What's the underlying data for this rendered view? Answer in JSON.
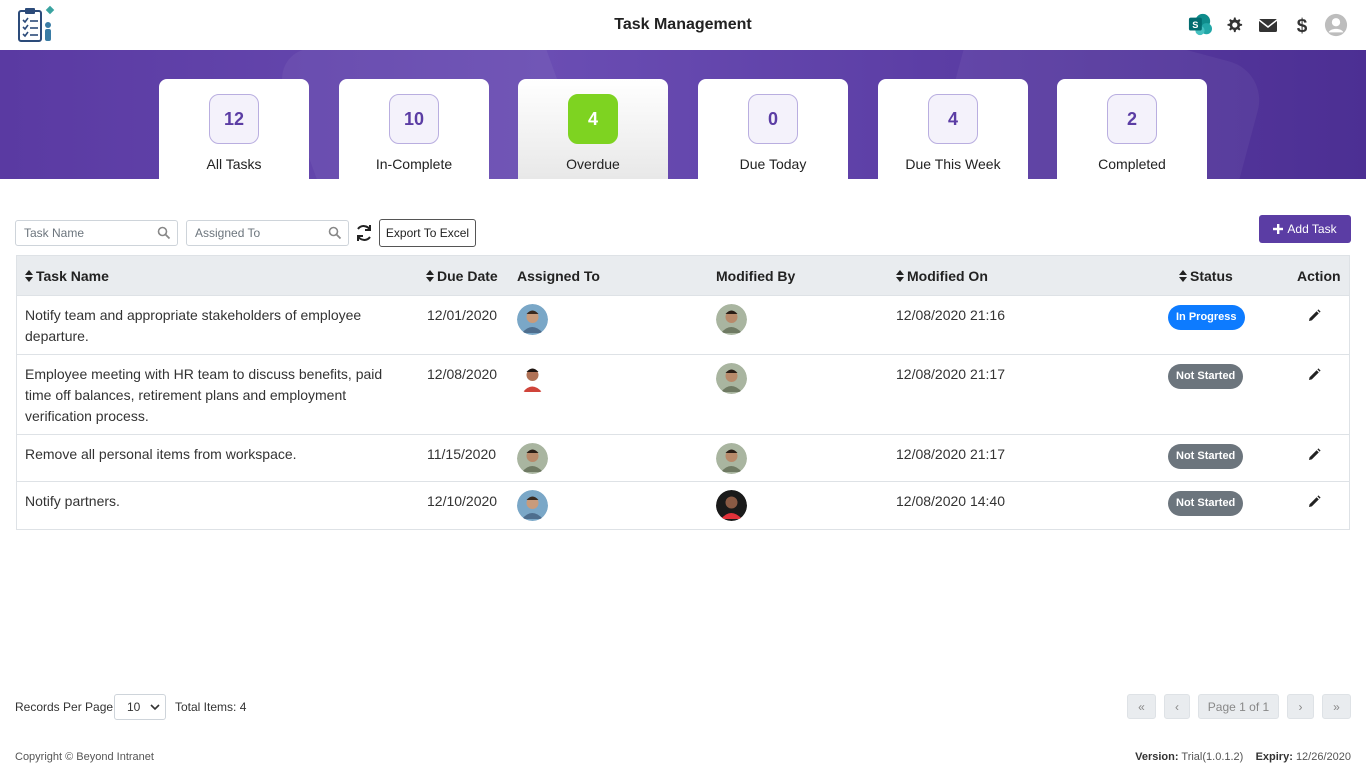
{
  "header": {
    "title": "Task Management",
    "icons": [
      "sharepoint-icon",
      "gear-icon",
      "envelope-icon",
      "dollar-icon",
      "user-avatar-icon"
    ]
  },
  "tiles": [
    {
      "count": "12",
      "label": "All Tasks",
      "active": false
    },
    {
      "count": "10",
      "label": "In-Complete",
      "active": false
    },
    {
      "count": "4",
      "label": "Overdue",
      "active": true
    },
    {
      "count": "0",
      "label": "Due Today",
      "active": false
    },
    {
      "count": "4",
      "label": "Due This Week",
      "active": false
    },
    {
      "count": "2",
      "label": "Completed",
      "active": false
    }
  ],
  "filters": {
    "task_name_placeholder": "Task Name",
    "assigned_to_placeholder": "Assigned To",
    "export_label": "Export To Excel",
    "add_task_label": "Add Task"
  },
  "table": {
    "columns": {
      "task_name": "Task Name",
      "due_date": "Due Date",
      "assigned_to": "Assigned To",
      "modified_by": "Modified By",
      "modified_on": "Modified On",
      "status": "Status",
      "action": "Action"
    },
    "rows": [
      {
        "task_name": "Notify team and appropriate stakeholders of employee departure.",
        "due_date": "12/01/2020",
        "modified_on": "12/08/2020 21:16",
        "status": "In Progress"
      },
      {
        "task_name": "Employee meeting with HR team to discuss benefits, paid time off balances, retirement plans and employment verification process.",
        "due_date": "12/08/2020",
        "modified_on": "12/08/2020 21:17",
        "status": "Not Started"
      },
      {
        "task_name": "Remove all personal items from workspace.",
        "due_date": "11/15/2020",
        "modified_on": "12/08/2020 21:17",
        "status": "Not Started"
      },
      {
        "task_name": "Notify partners.",
        "due_date": "12/10/2020",
        "modified_on": "12/08/2020 14:40",
        "status": "Not Started"
      }
    ]
  },
  "footer": {
    "records_per_page_label": "Records Per Page",
    "records_per_page_value": "10",
    "total_items": "Total Items: 4",
    "page_info": "Page 1 of 1",
    "first": "«",
    "prev": "‹",
    "next": "›",
    "last": "»",
    "copyright": "Copyright © Beyond Intranet",
    "version_label": "Version:",
    "version_value": "Trial(1.0.1.2)",
    "expiry_label": "Expiry:",
    "expiry_value": "12/26/2020"
  },
  "colors": {
    "brand": "#5b3da4",
    "active_tile": "#7ed321",
    "in_progress": "#0d7bff",
    "not_started": "#6c757d"
  }
}
